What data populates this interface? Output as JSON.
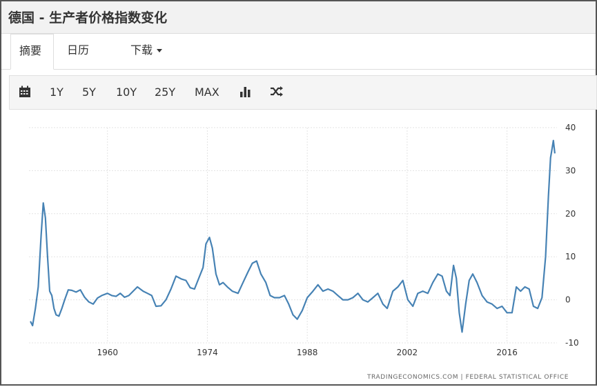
{
  "header": {
    "title": "德国 - 生产者价格指数变化"
  },
  "tabs": [
    {
      "label": "摘要"
    },
    {
      "label": "日历"
    },
    {
      "label": "下载"
    }
  ],
  "toolbar": {
    "ranges": [
      "1Y",
      "5Y",
      "10Y",
      "25Y",
      "MAX"
    ],
    "icons": [
      "calendar-icon",
      "bar-chart-icon",
      "shuffle-icon"
    ]
  },
  "footer": {
    "source": "TRADINGECONOMICS.COM  |  FEDERAL STATISTICAL OFFICE"
  },
  "chart_data": {
    "type": "line",
    "title": "",
    "xlabel": "",
    "ylabel": "",
    "xlim": [
      1949,
      2023
    ],
    "ylim": [
      -10,
      40
    ],
    "grid": true,
    "yaxis_side": "right",
    "x_ticks": [
      "1960",
      "1974",
      "1988",
      "2002",
      "2016"
    ],
    "y_ticks": [
      "40",
      "30",
      "20",
      "10",
      "0",
      "-10"
    ],
    "series": [
      {
        "color": "#4682b4",
        "x": [
          1949.2,
          1949.5,
          1949.9,
          1950.3,
          1950.7,
          1951.0,
          1951.3,
          1951.6,
          1951.9,
          1952.2,
          1952.5,
          1952.8,
          1953.2,
          1953.6,
          1954.0,
          1954.5,
          1955.0,
          1955.6,
          1956.2,
          1956.8,
          1957.4,
          1958.0,
          1958.6,
          1959.2,
          1960.0,
          1960.6,
          1961.2,
          1961.8,
          1962.4,
          1963.0,
          1963.6,
          1964.2,
          1965.0,
          1965.6,
          1966.2,
          1966.8,
          1967.5,
          1968.2,
          1968.9,
          1969.6,
          1970.4,
          1971.0,
          1971.6,
          1972.2,
          1972.8,
          1973.4,
          1973.8,
          1974.3,
          1974.7,
          1975.2,
          1975.7,
          1976.2,
          1976.8,
          1977.5,
          1978.3,
          1979.0,
          1979.7,
          1980.3,
          1980.9,
          1981.5,
          1982.2,
          1982.8,
          1983.4,
          1984.1,
          1984.8,
          1985.4,
          1986.0,
          1986.6,
          1987.3,
          1988.0,
          1988.8,
          1989.5,
          1990.2,
          1990.9,
          1991.6,
          1992.3,
          1993.0,
          1993.7,
          1994.4,
          1995.1,
          1995.8,
          1996.5,
          1997.2,
          1997.9,
          1998.6,
          1999.2,
          2000.0,
          2000.7,
          2001.4,
          2002.1,
          2002.8,
          2003.5,
          2004.2,
          2004.9,
          2005.6,
          2006.3,
          2006.9,
          2007.5,
          2008.0,
          2008.5,
          2008.9,
          2009.3,
          2009.7,
          2010.2,
          2010.7,
          2011.2,
          2011.8,
          2012.5,
          2013.2,
          2013.9,
          2014.6,
          2015.3,
          2016.0,
          2016.7,
          2017.3,
          2017.9,
          2018.5,
          2019.1,
          2019.7,
          2020.3,
          2020.9,
          2021.4,
          2021.8,
          2022.1,
          2022.3,
          2022.5,
          2022.7
        ],
        "y": [
          -5,
          -6,
          -2,
          3,
          15,
          22.5,
          19,
          10,
          2,
          1,
          -2,
          -3.5,
          -3.8,
          -2,
          0,
          2.3,
          2.2,
          1.8,
          2.3,
          0.6,
          -0.5,
          -1,
          0.4,
          1,
          1.5,
          1,
          0.8,
          1.5,
          0.6,
          1,
          2,
          3,
          2,
          1.5,
          1,
          -1.5,
          -1.4,
          0,
          2.5,
          5.5,
          4.8,
          4.5,
          2.8,
          2.5,
          5,
          7.5,
          13,
          14.5,
          12,
          6,
          3.5,
          4,
          3,
          2,
          1.5,
          4,
          6.5,
          8.5,
          9,
          6,
          4,
          1,
          0.5,
          0.5,
          1,
          -1,
          -3.5,
          -4.5,
          -2.5,
          0.5,
          2,
          3.5,
          2,
          2.5,
          2,
          1,
          0,
          0,
          0.5,
          1.5,
          0,
          -0.5,
          0.5,
          1.5,
          -1,
          -2,
          2,
          3,
          4.5,
          0,
          -1.5,
          1.5,
          2,
          1.5,
          4,
          6,
          5.5,
          2,
          1,
          8,
          5,
          -3,
          -7.5,
          -1,
          4.5,
          6,
          4,
          1,
          -0.5,
          -1,
          -2,
          -1.5,
          -3,
          -3,
          3,
          2,
          3,
          2.5,
          -1.5,
          -2,
          0.5,
          10,
          24,
          33,
          35,
          37,
          34
        ]
      }
    ]
  }
}
